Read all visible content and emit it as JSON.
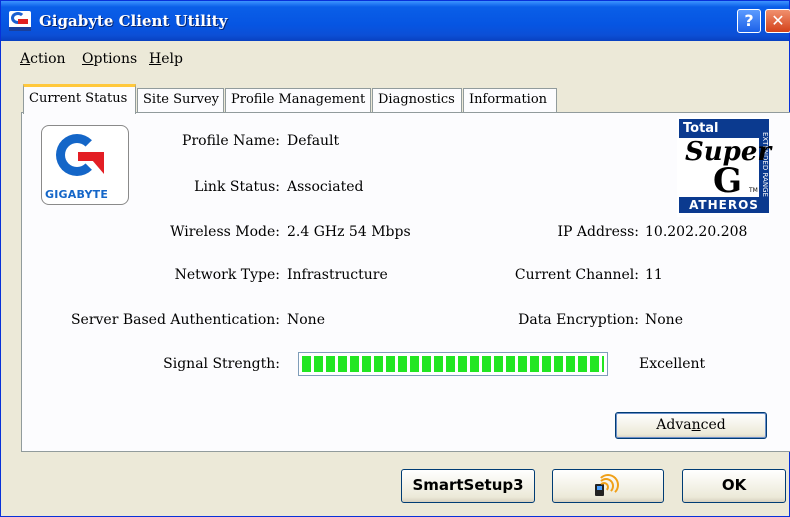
{
  "window": {
    "title": "Gigabyte Client Utility"
  },
  "titlebar": {
    "help_label": "?",
    "close_label": "✕"
  },
  "menu": [
    {
      "accel": "A",
      "rest": "ction"
    },
    {
      "accel": "O",
      "rest": "ptions"
    },
    {
      "accel": "H",
      "rest": "elp"
    }
  ],
  "tabs": [
    "Current Status",
    "Site Survey",
    "Profile Management",
    "Diagnostics",
    "Information"
  ],
  "active_tab": "Current Status",
  "logo": {
    "brand": "GIGABYTE"
  },
  "badge": {
    "total": "Total 802.11",
    "super": "Super",
    "g": "G",
    "tm": "TM",
    "vendor": "ATHEROS",
    "range": "EXTENDED RANGE"
  },
  "status": {
    "profile_name": {
      "label": "Profile Name:",
      "value": "Default"
    },
    "link_status": {
      "label": "Link Status:",
      "value": "Associated"
    },
    "wireless_mode": {
      "label": "Wireless Mode:",
      "value": "2.4 GHz 54 Mbps"
    },
    "ip_address": {
      "label": "IP Address:",
      "value": "10.202.20.208"
    },
    "network_type": {
      "label": "Network Type:",
      "value": "Infrastructure"
    },
    "current_channel": {
      "label": "Current Channel:",
      "value": "11"
    },
    "server_auth": {
      "label": "Server Based Authentication:",
      "value": "None"
    },
    "data_encryption": {
      "label": "Data Encryption:",
      "value": "None"
    },
    "signal_strength": {
      "label": "Signal Strength:",
      "value": "Excellent",
      "level": 1.0
    }
  },
  "buttons": {
    "advanced": {
      "before": "Adva",
      "accel": "n",
      "after": "ced"
    },
    "smartsetup": "SmartSetup3",
    "ok": "OK"
  },
  "icons": {
    "wps_button": "wireless-signal-icon",
    "app": "gigabyte-icon"
  },
  "colors": {
    "titlebar": "#0655e2",
    "tab_highlight": "#ffc83c",
    "signal": "#22e622",
    "brand_blue": "#1466c8",
    "brand_red": "#e31e24"
  }
}
